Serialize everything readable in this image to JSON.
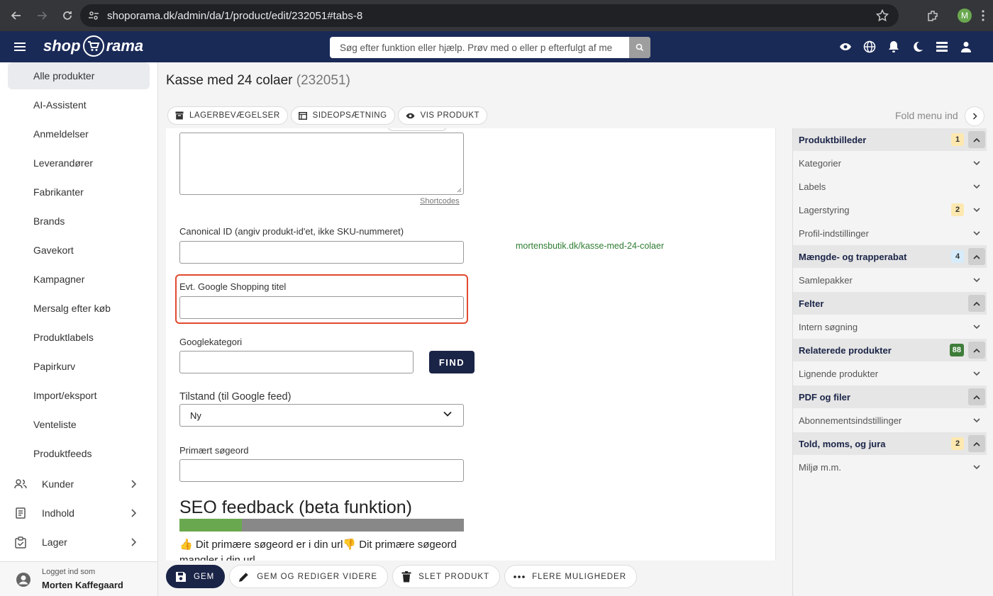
{
  "browser": {
    "url": "shoporama.dk/admin/da/1/product/edit/232051#tabs-8",
    "profile_initial": "M"
  },
  "app": {
    "logo_left": "shop",
    "logo_right": "rama",
    "search_placeholder": "Søg efter funktion eller hjælp. Prøv med o eller p efterfulgt af me"
  },
  "sidebar": {
    "items": [
      {
        "label": "Alle produkter",
        "active": true
      },
      {
        "label": "AI-Assistent"
      },
      {
        "label": "Anmeldelser"
      },
      {
        "label": "Leverandører"
      },
      {
        "label": "Fabrikanter"
      },
      {
        "label": "Brands"
      },
      {
        "label": "Gavekort"
      },
      {
        "label": "Kampagner"
      },
      {
        "label": "Mersalg efter køb"
      },
      {
        "label": "Produktlabels"
      },
      {
        "label": "Papirkurv"
      },
      {
        "label": "Import/eksport"
      },
      {
        "label": "Venteliste"
      },
      {
        "label": "Produktfeeds"
      }
    ],
    "groups": [
      {
        "label": "Kunder",
        "icon": "people-icon"
      },
      {
        "label": "Indhold",
        "icon": "document-icon"
      },
      {
        "label": "Lager",
        "icon": "clipboard-icon"
      }
    ],
    "user": {
      "logged_in_as": "Logget ind som",
      "name": "Morten Kaffegaard"
    }
  },
  "page": {
    "title": "Kasse med 24 colaer",
    "id": "(232051)",
    "tabs": [
      {
        "label": "LAGERBEVÆGELSER",
        "icon": "archive-icon"
      },
      {
        "label": "SIDEOPSÆTNING",
        "icon": "layout-icon"
      },
      {
        "label": "VIS PRODUKT",
        "icon": "eye-icon"
      }
    ],
    "fold_menu": "Fold menu ind"
  },
  "form": {
    "shortcodes": "Shortcodes",
    "canonical_label": "Canonical ID (angiv produkt-id'et, ikke SKU-nummeret)",
    "canonical_value": "",
    "url_preview": "mortensbutik.dk/kasse-med-24-colaer",
    "gshop_title_label": "Evt. Google Shopping titel",
    "gshop_title_value": "",
    "googlecat_label": "Googlekategori",
    "googlecat_value": "",
    "find_button": "FIND",
    "condition_label": "Tilstand (til Google feed)",
    "condition_value": "Ny",
    "keyword_label": "Primært søgeord",
    "keyword_value": "",
    "seo_title": "SEO feedback (beta funktion)",
    "seo_progress": 0.22,
    "seo_text": "👍 Dit primære søgeord er i din url👎 Dit primære søgeord mangler i din url"
  },
  "right_panel": {
    "items": [
      {
        "label": "Produktbilleder",
        "open": true,
        "badge": "1",
        "badge_color": "#fde8b0"
      },
      {
        "label": "Kategorier",
        "open": false
      },
      {
        "label": "Labels",
        "open": false
      },
      {
        "label": "Lagerstyring",
        "open": false,
        "badge": "2",
        "badge_color": "#fde8b0"
      },
      {
        "label": "Profil-indstillinger",
        "open": false
      },
      {
        "label": "Mængde- og trapperabat",
        "open": true,
        "badge": "4",
        "badge_color": "#d6ecfb"
      },
      {
        "label": "Samlepakker",
        "open": false
      },
      {
        "label": "Felter",
        "open": true
      },
      {
        "label": "Intern søgning",
        "open": false
      },
      {
        "label": "Relaterede produkter",
        "open": true,
        "badge": "88",
        "badge_color": "#3f7d3a"
      },
      {
        "label": "Lignende produkter",
        "open": false
      },
      {
        "label": "PDF og filer",
        "open": true
      },
      {
        "label": "Abonnementsindstillinger",
        "open": false
      },
      {
        "label": "Told, moms, og jura",
        "open": true,
        "badge": "2",
        "badge_color": "#fde8b0"
      },
      {
        "label": "Miljø m.m.",
        "open": false
      }
    ]
  },
  "bottom_actions": [
    {
      "label": "GEM",
      "icon": "save-icon",
      "primary": true
    },
    {
      "label": "GEM OG REDIGER VIDERE",
      "icon": "pencil-icon"
    },
    {
      "label": "SLET PRODUKT",
      "icon": "trash-icon"
    },
    {
      "label": "FLERE MULIGHEDER",
      "icon": "more-icon"
    }
  ]
}
